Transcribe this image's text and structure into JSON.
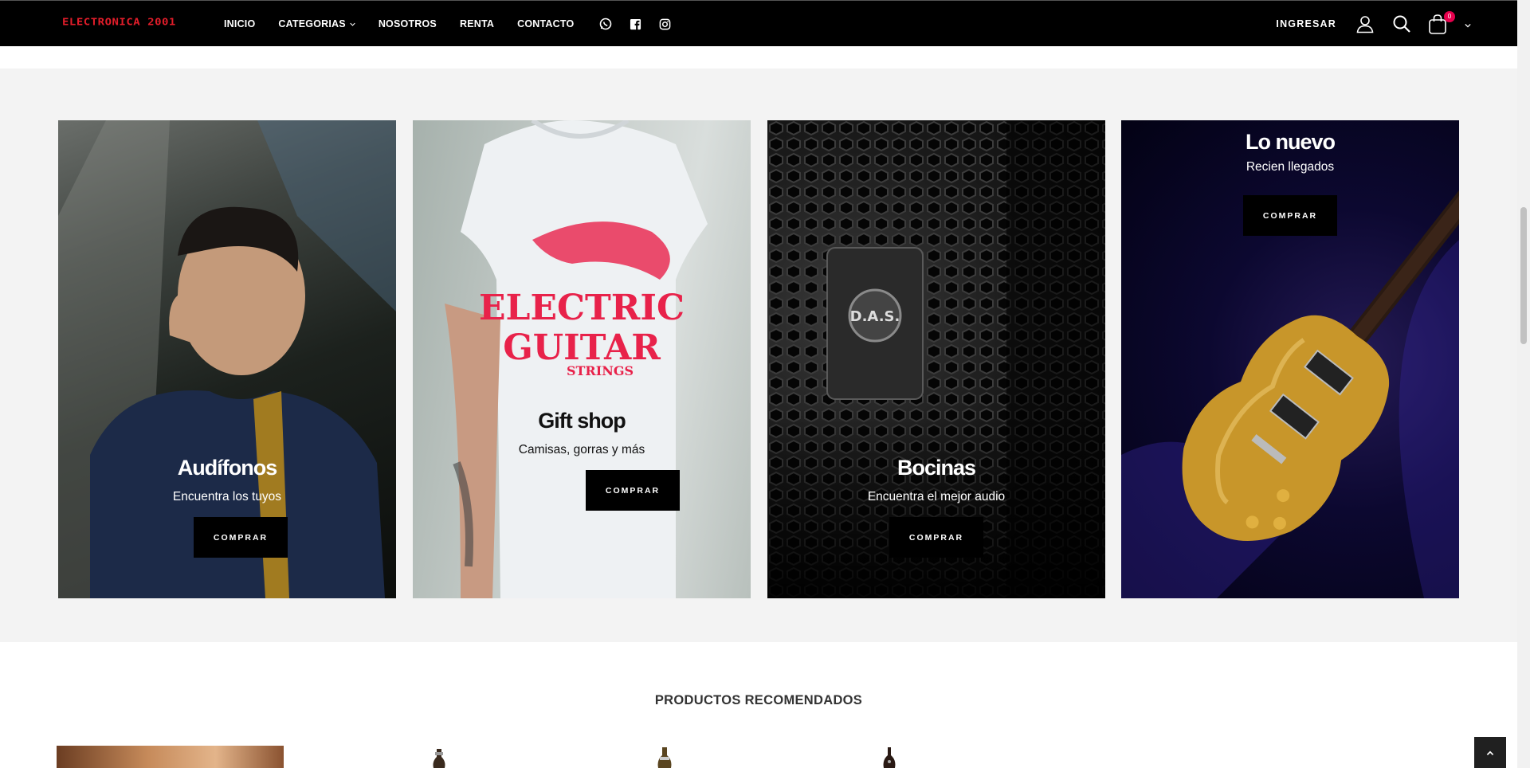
{
  "header": {
    "logo_text": "ELECTRONICA 2001",
    "nav": [
      {
        "label": "INICIO"
      },
      {
        "label": "CATEGORIAS"
      },
      {
        "label": "NOSOTROS"
      },
      {
        "label": "RENTA"
      },
      {
        "label": "CONTACTO"
      }
    ],
    "social_icons": [
      "whatsapp-icon",
      "facebook-icon",
      "instagram-icon"
    ],
    "login_label": "INGRESAR",
    "cart_count": "0"
  },
  "banners": [
    {
      "title": "Audífonos",
      "subtitle": "Encuentra los tuyos",
      "button": "COMPRAR"
    },
    {
      "title": "Gift shop",
      "subtitle": "Camisas, gorras y más",
      "button": "COMPRAR"
    },
    {
      "title": "Bocinas",
      "subtitle": "Encuentra el mejor audio",
      "button": "COMPRAR"
    },
    {
      "title": "Lo nuevo",
      "subtitle": "Recien llegados",
      "button": "COMPRAR"
    }
  ],
  "recommended": {
    "title": "PRODUCTOS RECOMENDADOS"
  },
  "colors": {
    "accent": "#e11d2a",
    "badge": "#e6004d",
    "navbar": "#000000",
    "section_bg": "#f3f3f3"
  }
}
